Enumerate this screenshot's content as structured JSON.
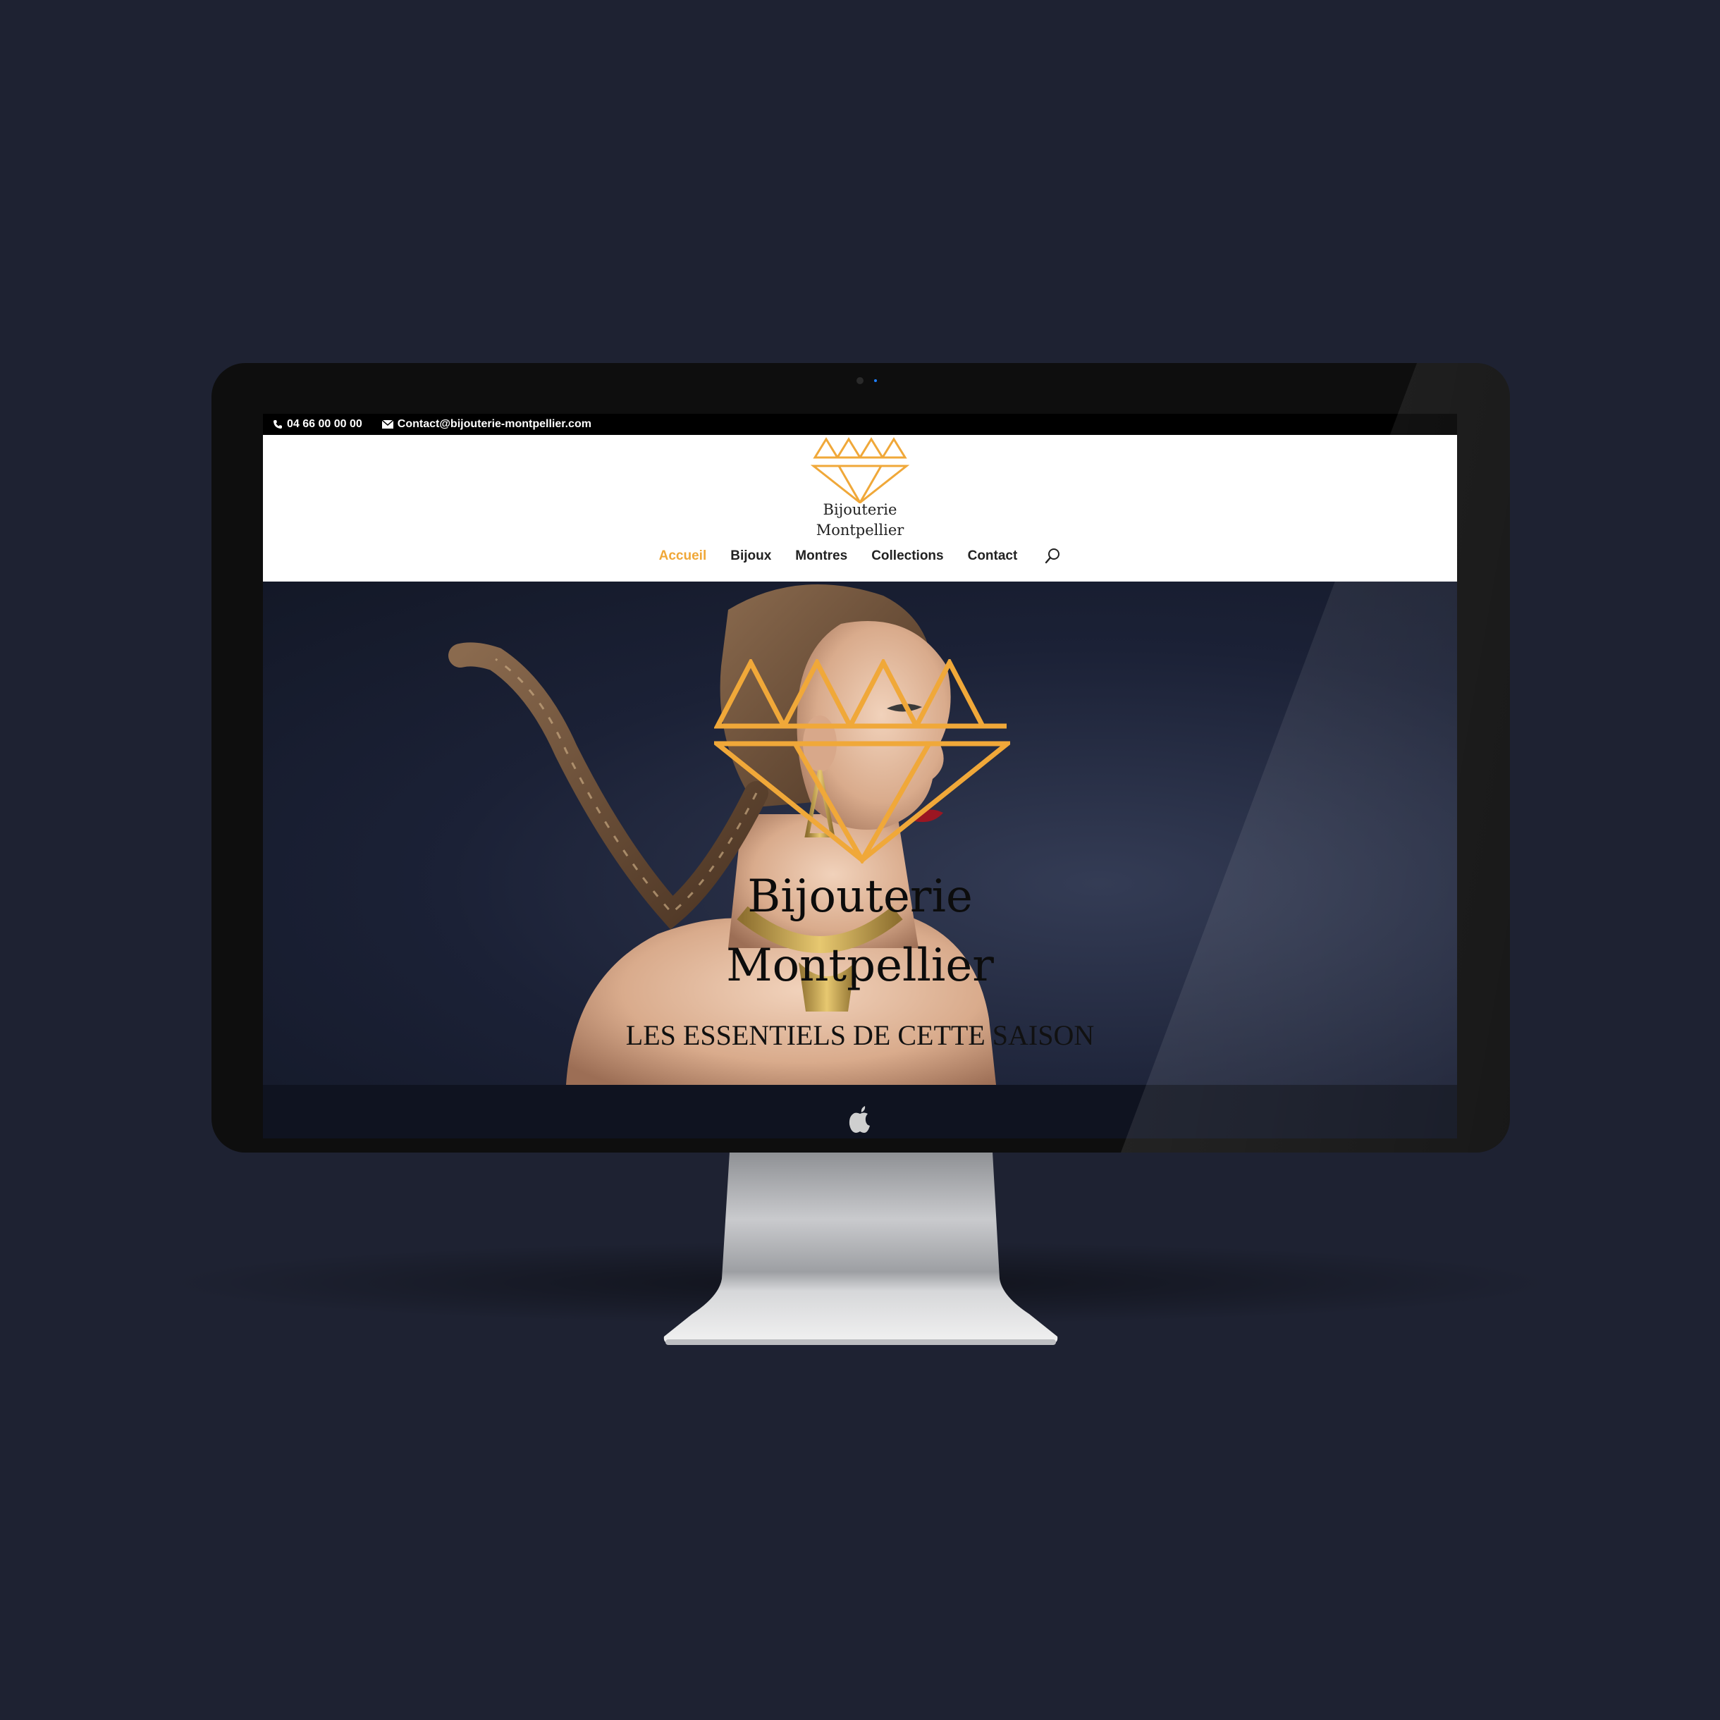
{
  "topbar": {
    "phone": "04 66 00 00 00",
    "email": "Contact@bijouterie-montpellier.com",
    "phone_icon": "phone-icon",
    "email_icon": "envelope-icon"
  },
  "brand": {
    "line1": "Bijouterie",
    "line2": "Montpellier",
    "logo_icon": "diamond-logo-icon"
  },
  "nav": {
    "items": [
      {
        "label": "Accueil",
        "active": true
      },
      {
        "label": "Bijoux",
        "active": false
      },
      {
        "label": "Montres",
        "active": false
      },
      {
        "label": "Collections",
        "active": false
      },
      {
        "label": "Contact",
        "active": false
      }
    ],
    "search_icon": "search-icon"
  },
  "hero": {
    "title_line1": "Bijouterie",
    "title_line2": "Montpellier",
    "subtitle": "LES ESSENTIELS DE CETTE SAISON"
  },
  "colors": {
    "accent": "#f0a839",
    "background": "#1e2232",
    "bezel": "#0e0e0e",
    "topbar": "#000000",
    "header": "#ffffff"
  }
}
